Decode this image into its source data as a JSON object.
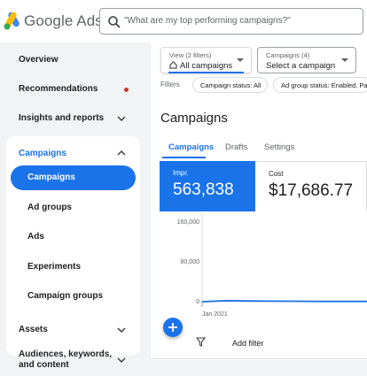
{
  "header": {
    "brand": "Google Ads",
    "search_placeholder": "\"What are my top performing campaigns?\""
  },
  "sidebar": {
    "items": [
      {
        "label": "Overview"
      },
      {
        "label": "Recommendations"
      },
      {
        "label": "Insights and reports"
      },
      {
        "label": "Campaigns"
      },
      {
        "label": "Assets"
      },
      {
        "label": "Audiences, keywords, and content"
      }
    ],
    "campaigns_group": {
      "title": "Campaigns",
      "subitems": [
        {
          "label": "Campaigns",
          "active": true
        },
        {
          "label": "Ad groups"
        },
        {
          "label": "Ads"
        },
        {
          "label": "Experiments"
        },
        {
          "label": "Campaign groups"
        }
      ]
    }
  },
  "main": {
    "view_selector": {
      "caption": "View (2 filters)",
      "value": "All campaigns"
    },
    "campaign_selector": {
      "caption": "Campaigns (4)",
      "value": "Select a campaign"
    },
    "filters_label": "Filters",
    "chips": [
      "Campaign status: All",
      "Ad group status: Enabled, Pa"
    ],
    "title": "Campaigns",
    "tabs": [
      {
        "label": "Campaigns",
        "active": true
      },
      {
        "label": "Drafts"
      },
      {
        "label": "Settings"
      }
    ],
    "metrics": [
      {
        "label": "Impr.",
        "value": "563,838"
      },
      {
        "label": "Cost",
        "value": "$17,686.77"
      }
    ],
    "add_filter": "Add filter"
  },
  "colors": {
    "accent": "#1a73e8",
    "notification_dot": "#d93025",
    "sidebar_bg": "#f1f3f4"
  },
  "chart_data": {
    "type": "line",
    "y_ticks": [
      "160,000",
      "80,000",
      "0"
    ],
    "ylim": [
      0,
      160000
    ],
    "x_label": "Jan 2021",
    "series": [
      {
        "values": [
          0,
          2000,
          1500,
          1000,
          800,
          600,
          500,
          500
        ]
      }
    ]
  }
}
